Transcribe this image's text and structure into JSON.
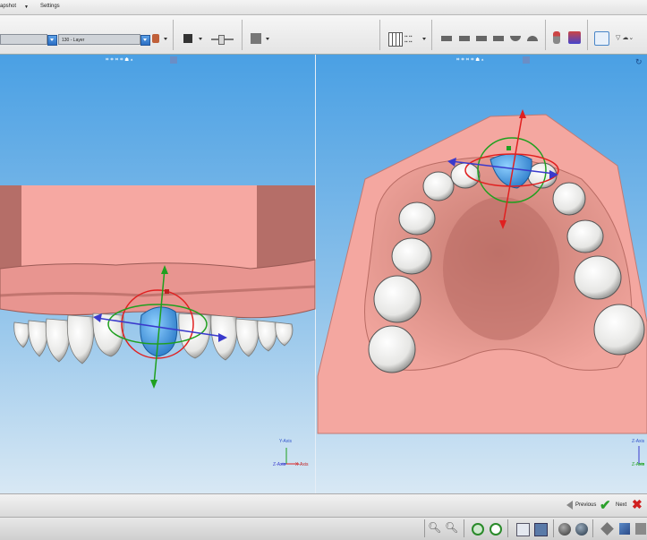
{
  "menu": {
    "snapshot": "apshot",
    "settings": "Settings"
  },
  "toolbar": {
    "layer_combo_value": "130 - Layer"
  },
  "nav": {
    "previous": "Previous",
    "next": "Next"
  },
  "axes": {
    "left": {
      "y": "Y-Axis",
      "z": "Z-Axis",
      "x": "X-Axis"
    },
    "right": {
      "z": "Z-Axis",
      "x": "Z-Axis"
    }
  },
  "colors": {
    "viewport_top": "#4aa0e4",
    "gum": "#f2a6a0",
    "tooth": "#f0f0ee",
    "selected_tooth": "#4fa8e8",
    "gizmo_red": "#e02020",
    "gizmo_green": "#1fa01f",
    "gizmo_blue": "#3a3acc",
    "next_check": "#2aa02a",
    "close_x": "#d02020"
  },
  "icons": [
    "grid-icon",
    "camera-icon",
    "zoom-in-icon",
    "zoom-out-icon",
    "fit-icon",
    "target-icon",
    "cube-icon",
    "check-icon",
    "close-icon",
    "previous-icon"
  ]
}
